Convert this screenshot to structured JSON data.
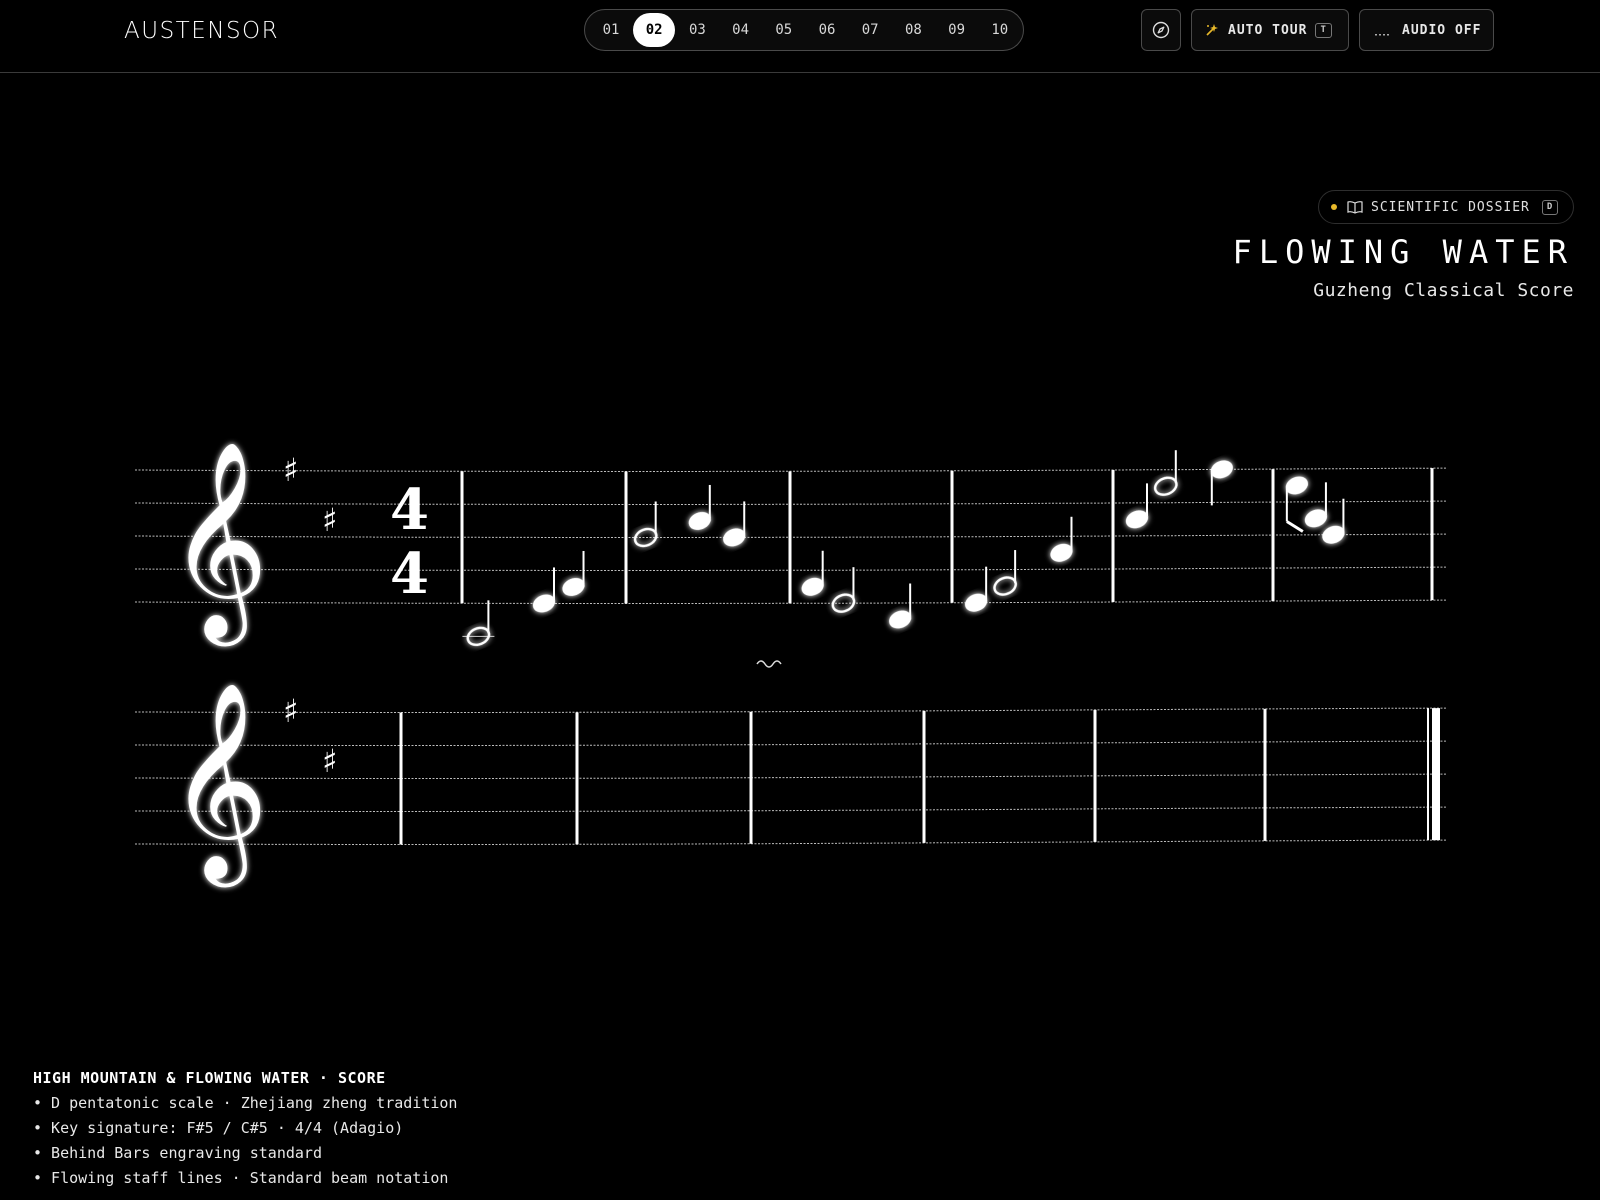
{
  "brand": {
    "logo": "AUSTENSOR"
  },
  "pager": {
    "pages": [
      "01",
      "02",
      "03",
      "04",
      "05",
      "06",
      "07",
      "08",
      "09",
      "10"
    ],
    "active_index": 1
  },
  "toolbar": {
    "compass_icon": "compass-icon",
    "auto_tour_label": "AUTO TOUR",
    "auto_tour_key": "T",
    "audio_label": "AUDIO OFF"
  },
  "dossier": {
    "label": "SCIENTIFIC DOSSIER",
    "key": "D",
    "status_color": "#e8b92a"
  },
  "header": {
    "title": "FLOWING WATER",
    "subtitle": "Guzheng Classical Score"
  },
  "score": {
    "clef": "𝄞",
    "sharp": "♯",
    "time_signature": {
      "top": "4",
      "bottom": "4"
    },
    "staff1_notes": [
      {
        "m": 1,
        "pos": 0.1,
        "step": -2,
        "type": "half",
        "stem": "up"
      },
      {
        "m": 1,
        "pos": 0.5,
        "step": 0,
        "type": "quarter",
        "stem": "up"
      },
      {
        "m": 1,
        "pos": 0.68,
        "step": 1,
        "type": "quarter",
        "stem": "up"
      },
      {
        "m": 2,
        "pos": 0.12,
        "step": 4,
        "type": "half",
        "stem": "up"
      },
      {
        "m": 2,
        "pos": 0.45,
        "step": 5,
        "type": "quarter",
        "stem": "up"
      },
      {
        "m": 2,
        "pos": 0.66,
        "step": 4,
        "type": "quarter",
        "stem": "up"
      },
      {
        "m": 3,
        "pos": 0.14,
        "step": 1,
        "type": "quarter",
        "stem": "up"
      },
      {
        "m": 3,
        "pos": 0.33,
        "step": 0,
        "type": "half",
        "stem": "up"
      },
      {
        "m": 3,
        "pos": 0.68,
        "step": -1,
        "type": "quarter",
        "stem": "up"
      },
      {
        "m": 4,
        "pos": 0.15,
        "step": 0,
        "type": "quarter",
        "stem": "up"
      },
      {
        "m": 4,
        "pos": 0.33,
        "step": 1,
        "type": "half",
        "stem": "up"
      },
      {
        "m": 4,
        "pos": 0.68,
        "step": 3,
        "type": "quarter",
        "stem": "up"
      },
      {
        "m": 5,
        "pos": 0.15,
        "step": 5,
        "type": "quarter",
        "stem": "up"
      },
      {
        "m": 5,
        "pos": 0.33,
        "step": 7,
        "type": "half",
        "stem": "up"
      },
      {
        "m": 5,
        "pos": 0.68,
        "step": 8,
        "type": "quarter",
        "stem": "down"
      },
      {
        "m": 6,
        "pos": 0.15,
        "step": 7,
        "type": "quarter",
        "stem": "down"
      },
      {
        "m": 6,
        "pos": 0.27,
        "step": 5,
        "type": "quarter",
        "stem": "up"
      },
      {
        "m": 6,
        "pos": 0.38,
        "step": 4,
        "type": "quarter",
        "stem": "up"
      }
    ]
  },
  "notes_panel": {
    "heading": "HIGH MOUNTAIN & FLOWING WATER · SCORE",
    "items": [
      "• D pentatonic scale · Zhejiang zheng tradition",
      "• Key signature: F#5 / C#5 · 4/4 (Adagio)",
      "• Behind Bars engraving standard",
      "• Flowing staff lines · Standard beam notation"
    ]
  }
}
